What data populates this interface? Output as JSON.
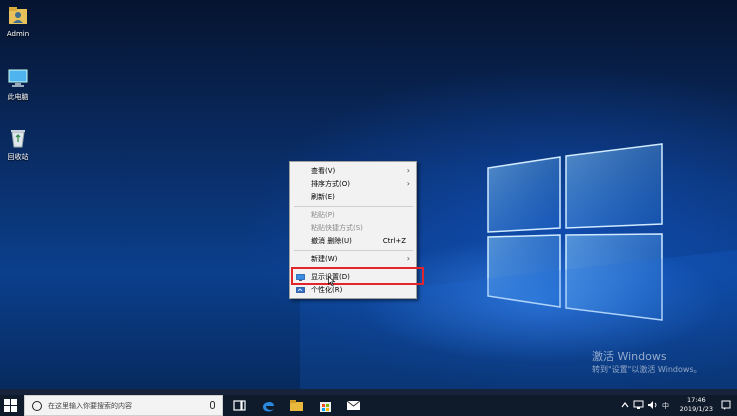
{
  "desktop": {
    "icons": [
      {
        "label": "Admin",
        "icon": "user-folder-icon"
      },
      {
        "label": "此电脑",
        "icon": "computer-icon"
      },
      {
        "label": "回收站",
        "icon": "recycle-bin-icon"
      }
    ]
  },
  "context_menu": {
    "items": {
      "view": {
        "label": "查看(V)",
        "submenu": true
      },
      "sort": {
        "label": "排序方式(O)",
        "submenu": true
      },
      "refresh": {
        "label": "刷新(E)"
      },
      "paste": {
        "label": "粘贴(P)",
        "disabled": true
      },
      "paste_shortcut": {
        "label": "粘贴快捷方式(S)",
        "disabled": true
      },
      "undo_delete": {
        "label": "撤消 删除(U)",
        "shortcut": "Ctrl+Z"
      },
      "new": {
        "label": "新建(W)",
        "submenu": true
      },
      "display": {
        "label": "显示设置(D)",
        "icon": "display-settings-icon",
        "highlighted": true
      },
      "personalize": {
        "label": "个性化(R)",
        "icon": "personalize-icon"
      }
    }
  },
  "highlight_color": "#e2242c",
  "watermark": {
    "line1": "激活 Windows",
    "line2": "转到\"设置\"以激活 Windows。"
  },
  "taskbar": {
    "search_placeholder": "在这里输入你要搜索的内容",
    "pinned": [
      "task-view-icon",
      "edge-icon",
      "file-explorer-icon",
      "store-icon",
      "mail-icon"
    ],
    "tray": {
      "ime": "中",
      "time": "17:46",
      "date": "2019/1/23"
    }
  }
}
